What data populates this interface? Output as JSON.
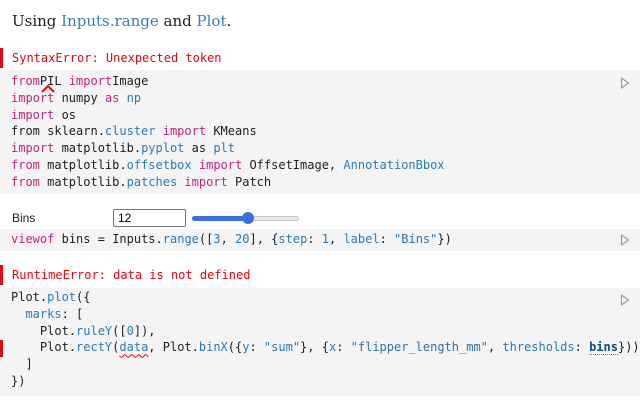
{
  "intro": {
    "prefix": "Using ",
    "link1": "Inputs.range",
    "middle": " and ",
    "link2": "Plot",
    "suffix": "."
  },
  "errors": {
    "syntax": "SyntaxError: Unexpected token",
    "runtime": "RuntimeError: data is not defined"
  },
  "cell1": {
    "lines": [
      [
        [
          "kw",
          "from"
        ],
        [
          "",
          "PIL "
        ],
        [
          "kw",
          "import"
        ],
        [
          "",
          "Image"
        ]
      ],
      [
        [
          "kw",
          "import"
        ],
        [
          "",
          " numpy "
        ],
        [
          "kw",
          "as"
        ],
        [
          "",
          " "
        ],
        [
          "nm",
          "np"
        ]
      ],
      [
        [
          "kw",
          "import"
        ],
        [
          "",
          " os"
        ]
      ],
      [
        [
          "",
          "from sklearn."
        ],
        [
          "nm",
          "cluster"
        ],
        [
          "",
          " "
        ],
        [
          "kw",
          "import"
        ],
        [
          "",
          " KMeans"
        ]
      ],
      [
        [
          "kw",
          "import"
        ],
        [
          "",
          " matplotlib."
        ],
        [
          "nm",
          "pyplot"
        ],
        [
          "",
          " as "
        ],
        [
          "nm",
          "plt"
        ]
      ],
      [
        [
          "kw",
          "from"
        ],
        [
          "",
          " matplotlib."
        ],
        [
          "nm",
          "offsetbox"
        ],
        [
          "",
          " "
        ],
        [
          "kw",
          "import"
        ],
        [
          "",
          " OffsetImage, "
        ],
        [
          "nm",
          "AnnotationBbox"
        ]
      ],
      [
        [
          "kw",
          "from"
        ],
        [
          "",
          " matplotlib."
        ],
        [
          "nm",
          "patches"
        ],
        [
          "",
          " "
        ],
        [
          "kw",
          "import"
        ],
        [
          "",
          " Patch"
        ]
      ]
    ]
  },
  "bins": {
    "label": "Bins",
    "value": "12",
    "min": 3,
    "max": 20,
    "step": 1
  },
  "cell2": {
    "lines": [
      [
        [
          "kw",
          "viewof"
        ],
        [
          "",
          " "
        ],
        [
          "",
          "bins"
        ],
        [
          "",
          " = "
        ],
        [
          "",
          "Inputs."
        ],
        [
          "nm",
          "range"
        ],
        [
          "",
          "(["
        ],
        [
          "num",
          "3"
        ],
        [
          "",
          ", "
        ],
        [
          "num",
          "20"
        ],
        [
          "",
          "], {"
        ],
        [
          "nm",
          "step"
        ],
        [
          "",
          ": "
        ],
        [
          "num",
          "1"
        ],
        [
          "",
          ", "
        ],
        [
          "nm",
          "label"
        ],
        [
          "",
          ": "
        ],
        [
          "str",
          "\"Bins\""
        ],
        [
          "",
          "})"
        ]
      ]
    ]
  },
  "cell3": {
    "lines": [
      [
        [
          "",
          "Plot."
        ],
        [
          "nm",
          "plot"
        ],
        [
          "",
          "({"
        ]
      ],
      [
        [
          "",
          "  "
        ],
        [
          "nm",
          "marks"
        ],
        [
          "",
          ": ["
        ]
      ],
      [
        [
          "",
          "    Plot."
        ],
        [
          "nm",
          "ruleY"
        ],
        [
          "",
          "(["
        ],
        [
          "num",
          "0"
        ],
        [
          "",
          "]),"
        ]
      ],
      [
        [
          "",
          "    Plot."
        ],
        [
          "nm",
          "rectY"
        ],
        [
          "",
          "("
        ],
        [
          "sq",
          "data"
        ],
        [
          "",
          ", Plot."
        ],
        [
          "nm",
          "binX"
        ],
        [
          "",
          "({"
        ],
        [
          "nm",
          "y"
        ],
        [
          "",
          ": "
        ],
        [
          "str",
          "\"sum\""
        ],
        [
          "",
          "}, {"
        ],
        [
          "nm",
          "x"
        ],
        [
          "",
          ": "
        ],
        [
          "str",
          "\"flipper_length_mm\""
        ],
        [
          "",
          ", "
        ],
        [
          "nm",
          "thresholds"
        ],
        [
          "",
          ": "
        ],
        [
          "bd",
          "bins"
        ],
        [
          "",
          "}))"
        ]
      ],
      [
        [
          "",
          "  ]"
        ]
      ],
      [
        [
          "",
          "})"
        ]
      ]
    ]
  }
}
